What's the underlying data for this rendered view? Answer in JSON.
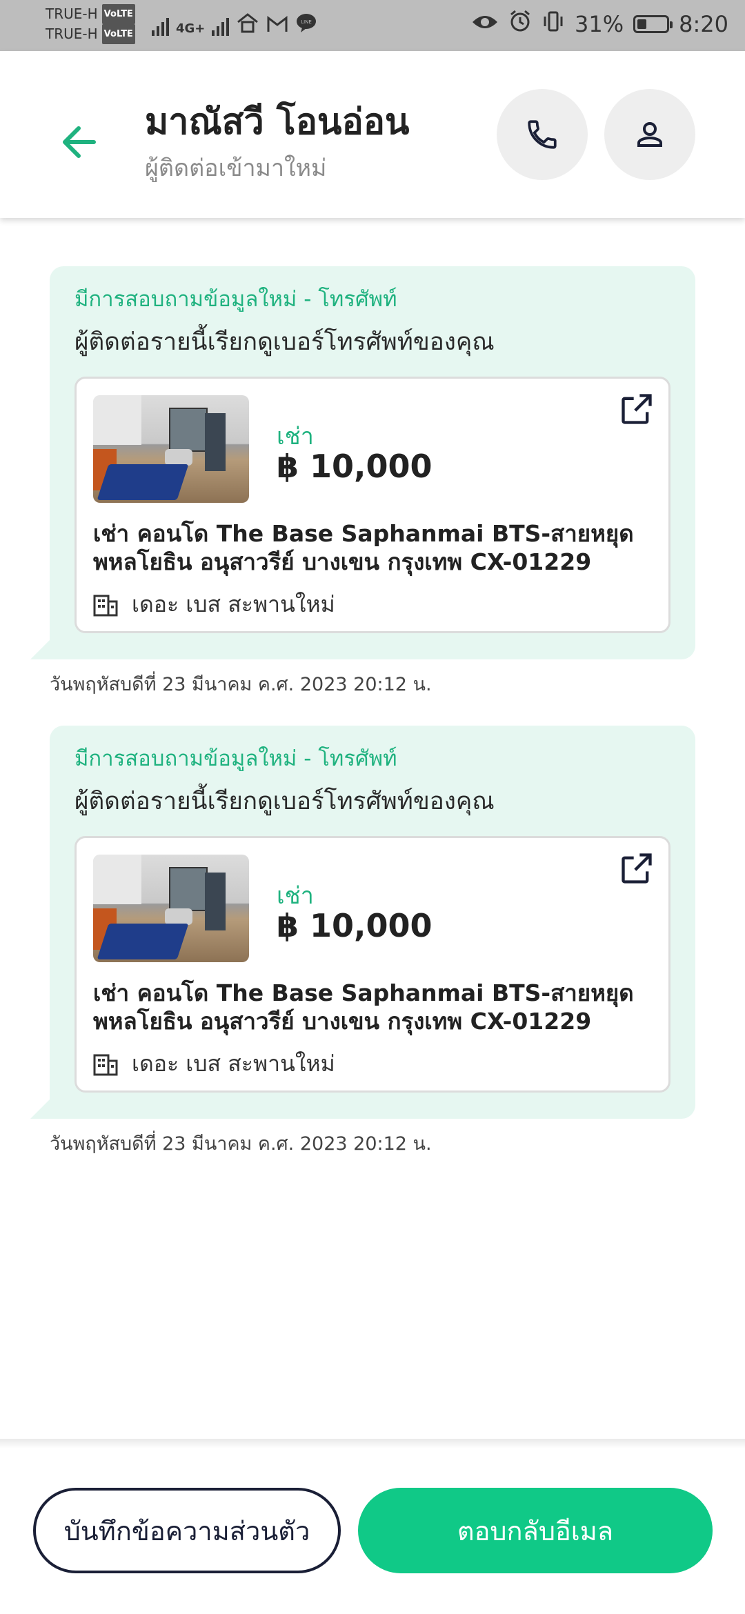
{
  "status_bar": {
    "carrier1": "TRUE-H",
    "carrier2": "TRUE-H",
    "volte": "VoLTE",
    "network": "4G+",
    "battery": "31%",
    "battery_level": 0.31,
    "time": "8:20"
  },
  "header": {
    "title": "มาณัสวี โอนอ่อน",
    "subtitle": "ผู้ติดต่อเข้ามาใหม่"
  },
  "messages": [
    {
      "title": "มีการสอบถามข้อมูลใหม่ - โทรศัพท์",
      "text": "ผู้ติดต่อรายนี้เรียกดูเบอร์โทรศัพท์ของคุณ",
      "listing": {
        "type": "เช่า",
        "price": "฿ 10,000",
        "title": "เช่า คอนโด  The Base Saphanmai BTS-สายหยุด พหลโยธิน อนุสาวรีย์ บางเขน กรุงเทพ CX-01229",
        "building": "เดอะ เบส สะพานใหม่"
      },
      "timestamp": "วันพฤหัสบดีที่ 23 มีนาคม ค.ศ. 2023 20:12 น."
    },
    {
      "title": "มีการสอบถามข้อมูลใหม่ - โทรศัพท์",
      "text": "ผู้ติดต่อรายนี้เรียกดูเบอร์โทรศัพท์ของคุณ",
      "listing": {
        "type": "เช่า",
        "price": "฿ 10,000",
        "title": "เช่า คอนโด  The Base Saphanmai BTS-สายหยุด พหลโยธิน อนุสาวรีย์ บางเขน กรุงเทพ CX-01229",
        "building": "เดอะ เบส สะพานใหม่"
      },
      "timestamp": "วันพฤหัสบดีที่ 23 มีนาคม ค.ศ. 2023 20:12 น."
    }
  ],
  "actions": {
    "note_label": "บันทึกข้อความส่วนตัว",
    "reply_label": "ตอบกลับอีเมล"
  },
  "colors": {
    "accent": "#10c987",
    "bubble": "#e6f7f1",
    "dark": "#1a1f36"
  }
}
